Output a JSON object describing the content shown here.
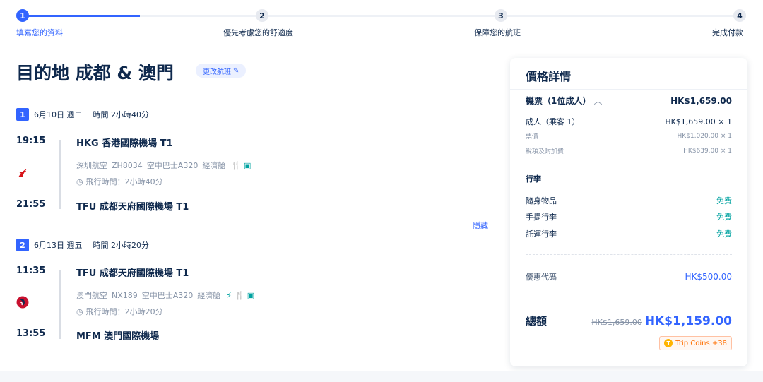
{
  "stepper": {
    "steps": [
      {
        "num": "1",
        "label": "填寫您的資料"
      },
      {
        "num": "2",
        "label": "優先考慮您的舒適度"
      },
      {
        "num": "3",
        "label": "保障您的航班"
      },
      {
        "num": "4",
        "label": "完成付款"
      }
    ]
  },
  "header": {
    "title": "目的地 成都 & 澳門",
    "change_label": "更改航班"
  },
  "segments": [
    {
      "num": "1",
      "date": "6月10日 週二",
      "duration_text": "時間 2小時40分",
      "dep_time": "19:15",
      "dep_airport": "HKG 香港國際機場 T1",
      "airline": "深圳航空",
      "flight_no": "ZH8034",
      "aircraft": "空中巴士A320",
      "cabin": "經濟艙",
      "flight_duration": "飛行時間：2小時40分",
      "arr_time": "21:55",
      "arr_airport": "TFU 成都天府國際機場 T1"
    },
    {
      "num": "2",
      "date": "6月13日 週五",
      "duration_text": "時間 2小時20分",
      "dep_time": "11:35",
      "dep_airport": "TFU 成都天府國際機場 T1",
      "airline": "澳門航空",
      "flight_no": "NX189",
      "aircraft": "空中巴士A320",
      "cabin": "經濟艙",
      "flight_duration": "飛行時間：2小時20分",
      "arr_time": "13:55",
      "arr_airport": "MFM 澳門國際機場"
    }
  ],
  "hide_label": "隱藏",
  "price": {
    "title": "價格詳情",
    "tickets_label": "機票（1位成人）",
    "tickets_total": "HK$1,659.00",
    "adult_label": "成人（乘客 1）",
    "adult_value": "HK$1,659.00 × 1",
    "fare_label": "票價",
    "fare_value": "HK$1,020.00 × 1",
    "tax_label": "稅項及附加費",
    "tax_value": "HK$639.00 × 1",
    "baggage_title": "行李",
    "baggage": [
      {
        "label": "隨身物品",
        "value": "免費"
      },
      {
        "label": "手提行李",
        "value": "免費"
      },
      {
        "label": "託運行李",
        "value": "免費"
      }
    ],
    "promo_label": "優惠代碼",
    "promo_value": "-HK$500.00",
    "total_label": "總額",
    "old_total": "HK$1,659.00",
    "new_total": "HK$1,159.00",
    "coins": "Trip Coins +38"
  },
  "colors": {
    "accent": "#3264ff",
    "teal": "#00a2a0",
    "text": "#0f294d",
    "muted": "#8592a6"
  }
}
